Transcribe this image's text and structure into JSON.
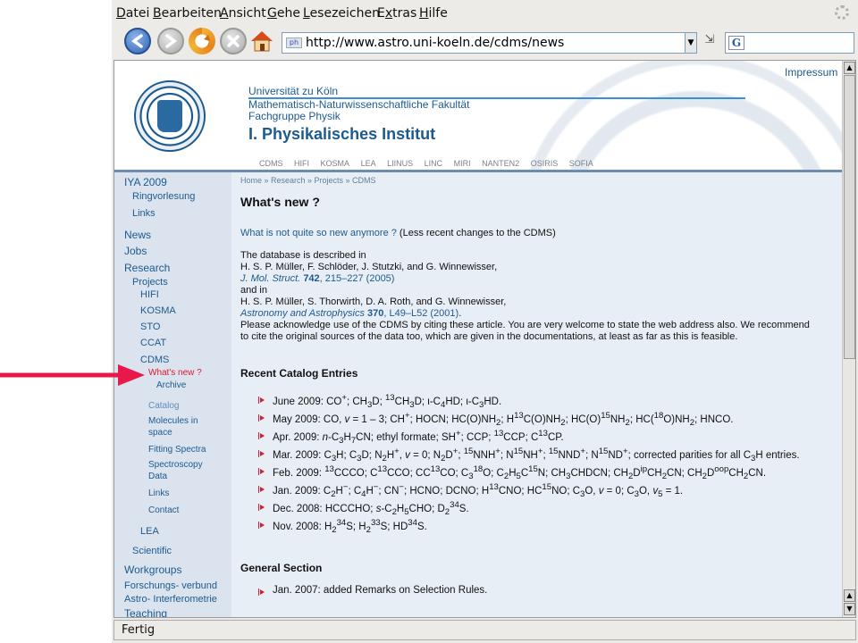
{
  "menu": {
    "items": [
      {
        "mnemonic": "D",
        "rest": "atei"
      },
      {
        "mnemonic": "B",
        "rest": "earbeiten"
      },
      {
        "mnemonic": "A",
        "rest": "nsicht"
      },
      {
        "mnemonic": "G",
        "rest": "ehe"
      },
      {
        "mnemonic": "L",
        "rest": "esezeichen"
      },
      {
        "pre": "E",
        "mnemonic": "x",
        "rest": "tras"
      },
      {
        "mnemonic": "H",
        "rest": "ilfe"
      }
    ]
  },
  "toolbar": {
    "url": "http://www.astro.uni-koeln.de/cdms/news",
    "search_engine_letter": "G"
  },
  "header": {
    "impressum": "Impressum",
    "university": "Universität zu Köln",
    "faculty": "Mathematisch-Naturwissenschaftliche Fakultät",
    "group": "Fachgruppe Physik",
    "institute": "I. Physikalisches Institut",
    "projects": [
      "CDMS",
      "HIFI",
      "KOSMA",
      "LEA",
      "LIINUS",
      "LINC",
      "MIRI",
      "NANTEN2",
      "OSIRIS",
      "SOFIA"
    ]
  },
  "sidebar": {
    "iya": "IYA 2009",
    "ringvorlesung": "Ringvorlesung",
    "links": "Links",
    "news": "News",
    "jobs": "Jobs",
    "research": "Research",
    "projects": "Projects",
    "hifi": "HIFI",
    "kosma": "KOSMA",
    "sto": "STO",
    "ccat": "CCAT",
    "cdms": "CDMS",
    "whats_new": "What's new ?",
    "archive": "Archive",
    "catalog": "Catalog",
    "molecules_1": "Molecules in",
    "molecules_2": "space",
    "fitting": "Fitting Spectra",
    "spectro_1": "Spectroscopy",
    "spectro_2": "Data",
    "links2": "Links",
    "contact": "Contact",
    "lea": "LEA",
    "scientific": "Scientific",
    "workgroups": "Workgroups",
    "forschung": "Forschungs- verbund",
    "astro": "Astro- Interferometrie",
    "teaching": "Teaching"
  },
  "main": {
    "breadcrumb": "Home » Research » Projects » CDMS",
    "title": "What's new ?",
    "older_link": "What is not quite so new anymore ?",
    "older_note": " (Less recent changes to the CDMS)",
    "desc_intro": "The database is described in",
    "ref1_authors": "H. S. P. Müller, F. Schlöder, J. Stutzki, and G. Winnewisser,",
    "ref1_journal": "J. Mol. Struct.",
    "ref1_vol": "742",
    "ref1_pages": ", 215–227 (2005)",
    "and_in": "and in",
    "ref2_authors": "H. S. P. Müller, S. Thorwirth, D. A. Roth, and G. Winnewisser,",
    "ref2_journal": "Astronomy and Astrophysics",
    "ref2_vol": "370",
    "ref2_pages": ", L49–L52 (2001)",
    "ref2_end": ".",
    "ack_1": "Please acknowledge use of the CDMS by citing these article. You are very welcome to state the web address also. We recommend",
    "ack_2": "to cite the original sources of the data too, which are given in the documentations, at least as far as this is feasible.",
    "recent_title": "Recent Catalog Entries",
    "general_title": "General Section",
    "general_entry": "Jan. 2007: added Remarks on Selection Rules."
  },
  "status": {
    "text": "Fertig"
  },
  "colors": {
    "link": "#1d5a8f",
    "active": "#e0192e",
    "sidebar_bg": "#dbe3ee",
    "main_bg": "#e8eef5"
  }
}
